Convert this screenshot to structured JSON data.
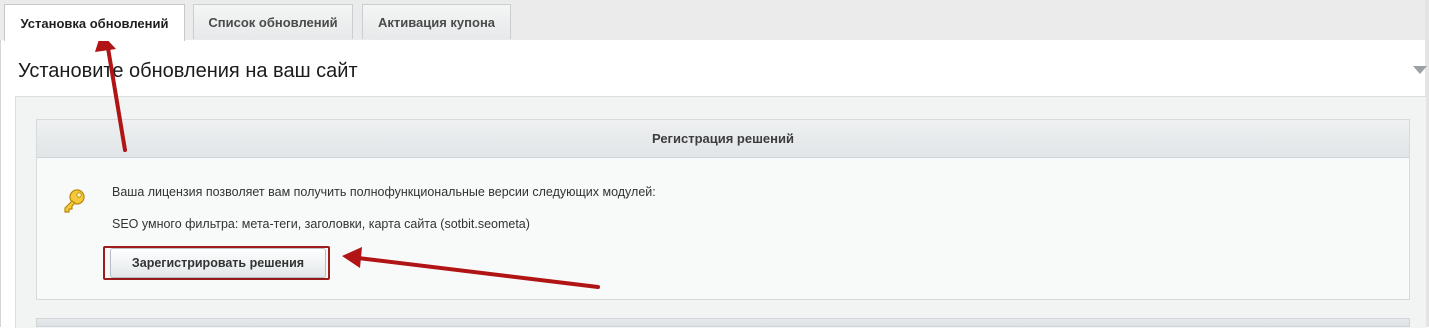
{
  "tabs": [
    {
      "label": "Установка обновлений",
      "active": true
    },
    {
      "label": "Список обновлений",
      "active": false
    },
    {
      "label": "Активация купона",
      "active": false
    }
  ],
  "page": {
    "title": "Установите обновления на ваш сайт"
  },
  "registration": {
    "header": "Регистрация решений",
    "license_text": "Ваша лицензия позволяет вам получить полнофункциональные версии следующих модулей:",
    "module_text": "SEO умного фильтра: мета-теги, заголовки, карта сайта (sotbit.seometa)",
    "button_label": "Зарегистрировать решения"
  },
  "icons": {
    "key": "key-icon",
    "collapse": "chevron-down-icon"
  },
  "colors": {
    "annotation_red": "#b01414",
    "header_bg": "#e4e8ea"
  }
}
